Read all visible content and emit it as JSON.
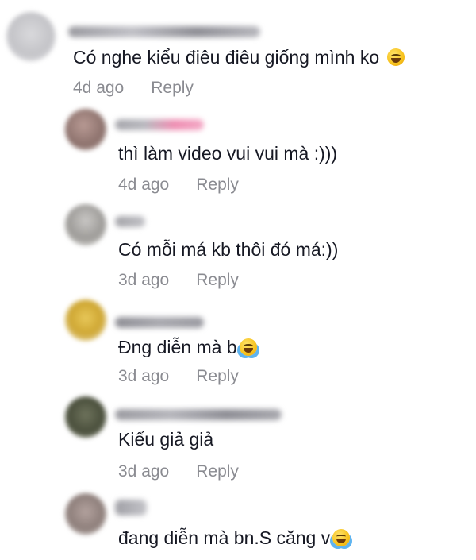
{
  "comments": [
    {
      "text": "Có nghe kiểu điêu điêu giống mình ko",
      "emoji": "sweat-smile-emoji",
      "time": "4d ago",
      "reply_label": "Reply"
    },
    {
      "text": "thì làm video vui vui mà :)))",
      "time": "4d ago",
      "reply_label": "Reply"
    },
    {
      "text": "Có mỗi má kb thôi đó má:))",
      "time": "3d ago",
      "reply_label": "Reply"
    },
    {
      "text": "Đng diễn mà b",
      "emoji": "tears-of-joy-emoji",
      "time": "3d ago",
      "reply_label": "Reply"
    },
    {
      "text": "Kiểu giả giả",
      "time": "3d ago",
      "reply_label": "Reply"
    },
    {
      "text": "đang diễn mà bn.S căng v",
      "emoji": "tears-of-joy-emoji"
    }
  ],
  "colors": {
    "text": "#161823",
    "meta": "#8a8b91",
    "background": "#ffffff"
  }
}
